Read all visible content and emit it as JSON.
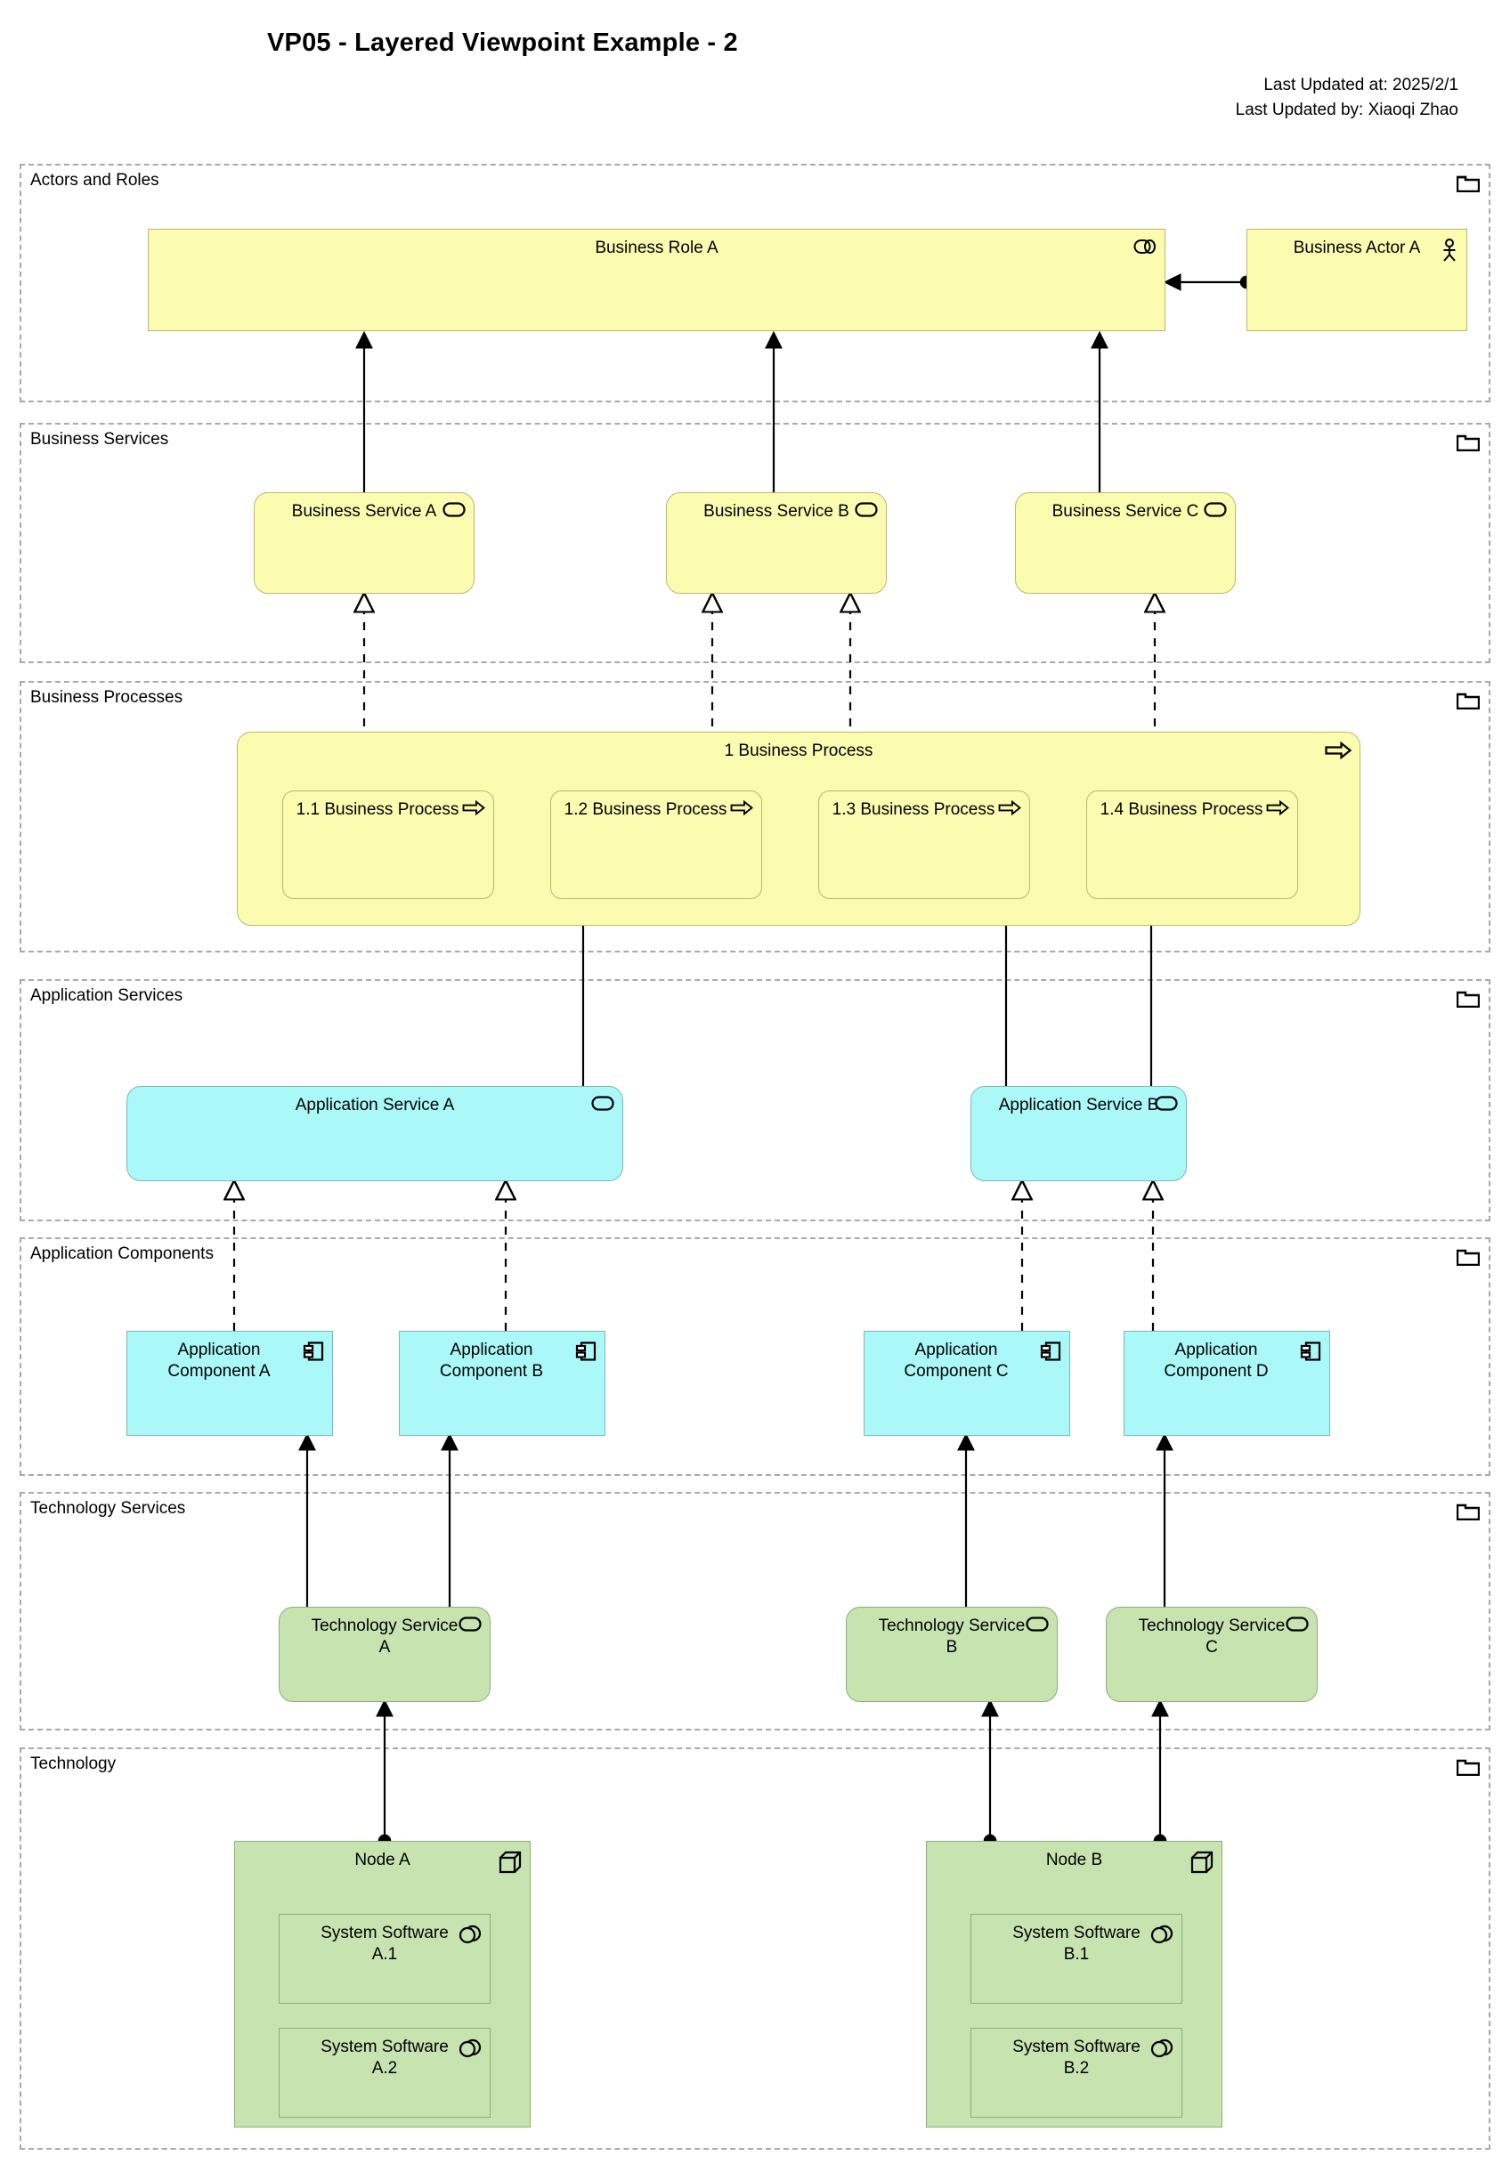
{
  "header": {
    "title": "VP05 - Layered Viewpoint Example - 2",
    "last_updated_at": "Last Updated at: 2025/2/1",
    "last_updated_by": "Last Updated by: Xiaoqi Zhao"
  },
  "layers": [
    {
      "label": "Actors and Roles"
    },
    {
      "label": "Business Services"
    },
    {
      "label": "Business Processes"
    },
    {
      "label": "Application Services"
    },
    {
      "label": "Application Components"
    },
    {
      "label": "Technology Services"
    },
    {
      "label": "Technology"
    }
  ],
  "elements": {
    "business_role_a": {
      "label": "Business Role A",
      "icon": "business-role-icon"
    },
    "business_actor_a": {
      "label": "Business Actor A",
      "icon": "business-actor-icon"
    },
    "business_service_a": {
      "label": "Business Service A",
      "icon": "business-service-icon"
    },
    "business_service_b": {
      "label": "Business Service B",
      "icon": "business-service-icon"
    },
    "business_service_c": {
      "label": "Business Service C",
      "icon": "business-service-icon"
    },
    "business_process_1": {
      "label": "1 Business Process",
      "icon": "business-process-icon"
    },
    "business_process_1_1": {
      "label": "1.1 Business Process",
      "icon": "business-process-icon"
    },
    "business_process_1_2": {
      "label": "1.2 Business Process",
      "icon": "business-process-icon"
    },
    "business_process_1_3": {
      "label": "1.3 Business Process",
      "icon": "business-process-icon"
    },
    "business_process_1_4": {
      "label": "1.4 Business Process",
      "icon": "business-process-icon"
    },
    "application_service_a": {
      "label": "Application Service A",
      "icon": "application-service-icon"
    },
    "application_service_b": {
      "label": "Application Service B",
      "icon": "application-service-icon"
    },
    "application_component_a": {
      "label": "Application Component A",
      "icon": "application-component-icon"
    },
    "application_component_b": {
      "label": "Application Component B",
      "icon": "application-component-icon"
    },
    "application_component_c": {
      "label": "Application Component C",
      "icon": "application-component-icon"
    },
    "application_component_d": {
      "label": "Application Component D",
      "icon": "application-component-icon"
    },
    "technology_service_a": {
      "label": "Technology Service A",
      "icon": "technology-service-icon"
    },
    "technology_service_b": {
      "label": "Technology Service B",
      "icon": "technology-service-icon"
    },
    "technology_service_c": {
      "label": "Technology Service C",
      "icon": "technology-service-icon"
    },
    "node_a": {
      "label": "Node A",
      "icon": "node-icon"
    },
    "node_b": {
      "label": "Node B",
      "icon": "node-icon"
    },
    "system_software_a1": {
      "label": "System Software A.1",
      "icon": "system-software-icon"
    },
    "system_software_a2": {
      "label": "System Software A.2",
      "icon": "system-software-icon"
    },
    "system_software_b1": {
      "label": "System Software B.1",
      "icon": "system-software-icon"
    },
    "system_software_b2": {
      "label": "System Software B.2",
      "icon": "system-software-icon"
    }
  },
  "colors": {
    "business": "#fcfcb0",
    "business_border": "#b9b96e",
    "application": "#aaf8f8",
    "application_border": "#7fb7b7",
    "technology": "#c7e3b0",
    "technology_border": "#8fae7d",
    "layer_border": "#a9a9a9",
    "connector": "#000000"
  }
}
